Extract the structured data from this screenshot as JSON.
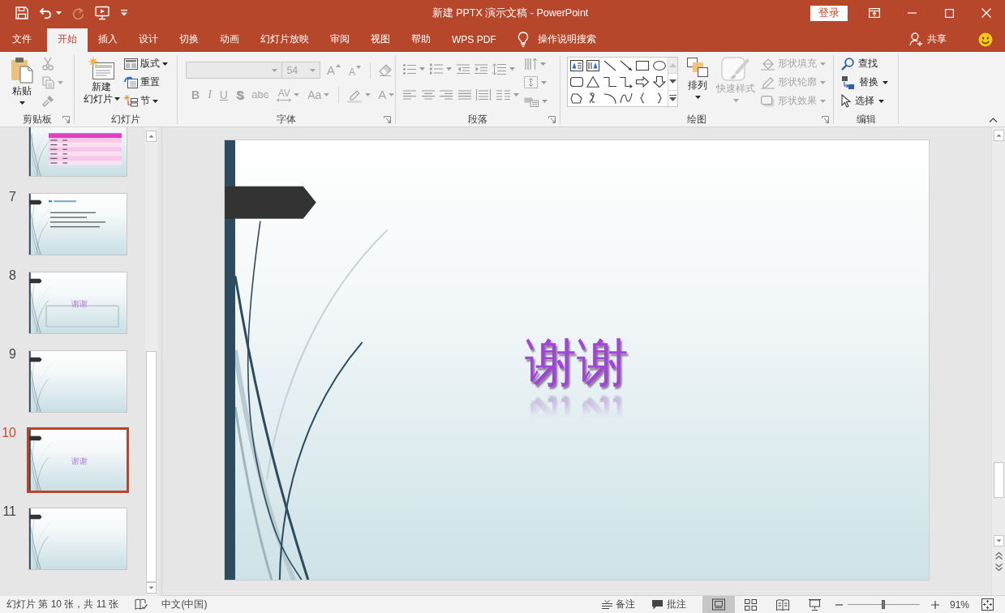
{
  "title_bar": {
    "quick_access": [
      {
        "kind": "save",
        "disabled": false
      },
      {
        "kind": "undo",
        "disabled": false
      },
      {
        "kind": "redo",
        "disabled": true
      },
      {
        "kind": "present",
        "disabled": false
      },
      {
        "kind": "customize",
        "disabled": false
      }
    ],
    "title": "新建 PPTX 演示文稿 - PowerPoint",
    "sign_in": "登录"
  },
  "ribbon_tabs": [
    {
      "label": "文件",
      "selected": false
    },
    {
      "label": "开始",
      "selected": true
    },
    {
      "label": "插入",
      "selected": false
    },
    {
      "label": "设计",
      "selected": false
    },
    {
      "label": "切换",
      "selected": false
    },
    {
      "label": "动画",
      "selected": false
    },
    {
      "label": "幻灯片放映",
      "selected": false
    },
    {
      "label": "审阅",
      "selected": false
    },
    {
      "label": "视图",
      "selected": false
    },
    {
      "label": "帮助",
      "selected": false
    },
    {
      "label": "WPS PDF",
      "selected": false
    }
  ],
  "tell_me": "操作说明搜索",
  "share": "共享",
  "ribbon": {
    "clipboard": {
      "label": "剪贴板",
      "paste": "粘贴",
      "tools": [
        {
          "kind": "cut",
          "disabled": true
        },
        {
          "kind": "copy",
          "disabled": true
        },
        {
          "kind": "format-painter",
          "disabled": true
        }
      ]
    },
    "slides": {
      "label": "幻灯片",
      "new_slide": [
        "新建",
        "幻灯片"
      ],
      "buttons": [
        {
          "kind": "layout",
          "label": "版式"
        },
        {
          "kind": "reset",
          "label": "重置"
        },
        {
          "kind": "section",
          "label": "节"
        }
      ]
    },
    "font": {
      "label": "字体",
      "font_name": {
        "disabled": true
      },
      "font_size": {
        "value": "54",
        "disabled": true
      },
      "size_tools": [
        {
          "kind": "grow",
          "label": "A",
          "disabled": true
        },
        {
          "kind": "shrink",
          "label": "A",
          "disabled": true
        },
        {
          "kind": "clear",
          "disabled": true
        }
      ],
      "format_tools": [
        {
          "kind": "bold",
          "label": "B",
          "disabled": true
        },
        {
          "kind": "italic",
          "label": "I",
          "disabled": true
        },
        {
          "kind": "underline",
          "label": "U",
          "disabled": true
        },
        {
          "kind": "shadow",
          "label": "S",
          "disabled": true
        },
        {
          "kind": "strikethrough",
          "label": "abc",
          "disabled": true
        },
        {
          "kind": "spacing",
          "label": "AV",
          "disabled": true
        },
        {
          "kind": "case",
          "label": "Aa",
          "disabled": true
        },
        {
          "kind": "highlight",
          "disabled": true
        },
        {
          "kind": "color",
          "label": "A",
          "disabled": true
        }
      ]
    },
    "paragraph": {
      "label": "段落",
      "disabled": true
    },
    "drawing": {
      "label": "绘图",
      "arrange": "排列",
      "quick_styles": {
        "label": "快速样式",
        "disabled": true
      },
      "shape_tools": [
        {
          "kind": "fill",
          "label": "形状填充",
          "disabled": true
        },
        {
          "kind": "outline",
          "label": "形状轮廓",
          "disabled": true
        },
        {
          "kind": "effects",
          "label": "形状效果",
          "disabled": true
        }
      ]
    },
    "editing": {
      "label": "编辑",
      "tools": [
        {
          "kind": "find",
          "label": "查找"
        },
        {
          "kind": "replace",
          "label": "替换"
        },
        {
          "kind": "select",
          "label": "选择"
        }
      ]
    }
  },
  "slides": [
    {
      "kind": "table",
      "selected": false
    },
    {
      "number": "7",
      "kind": "list",
      "selected": false
    },
    {
      "number": "8",
      "kind": "title-box",
      "title": "谢谢",
      "selected": false
    },
    {
      "number": "9",
      "kind": "blank",
      "selected": false
    },
    {
      "number": "10",
      "kind": "title",
      "title": "谢谢",
      "selected": true
    },
    {
      "number": "11",
      "kind": "blank",
      "selected": false
    }
  ],
  "current_slide": {
    "title": "谢谢"
  },
  "status_bar": {
    "slide_position": "幻灯片 第 10 张，共 11 张",
    "language": "中文(中国)",
    "notes": "备注",
    "comments": "批注",
    "views": [
      {
        "kind": "normal",
        "selected": true
      },
      {
        "kind": "sorter",
        "selected": false
      },
      {
        "kind": "reading",
        "selected": false
      },
      {
        "kind": "slideshow",
        "selected": false
      }
    ],
    "zoom": {
      "level": 0.5,
      "reading": "91%"
    }
  }
}
